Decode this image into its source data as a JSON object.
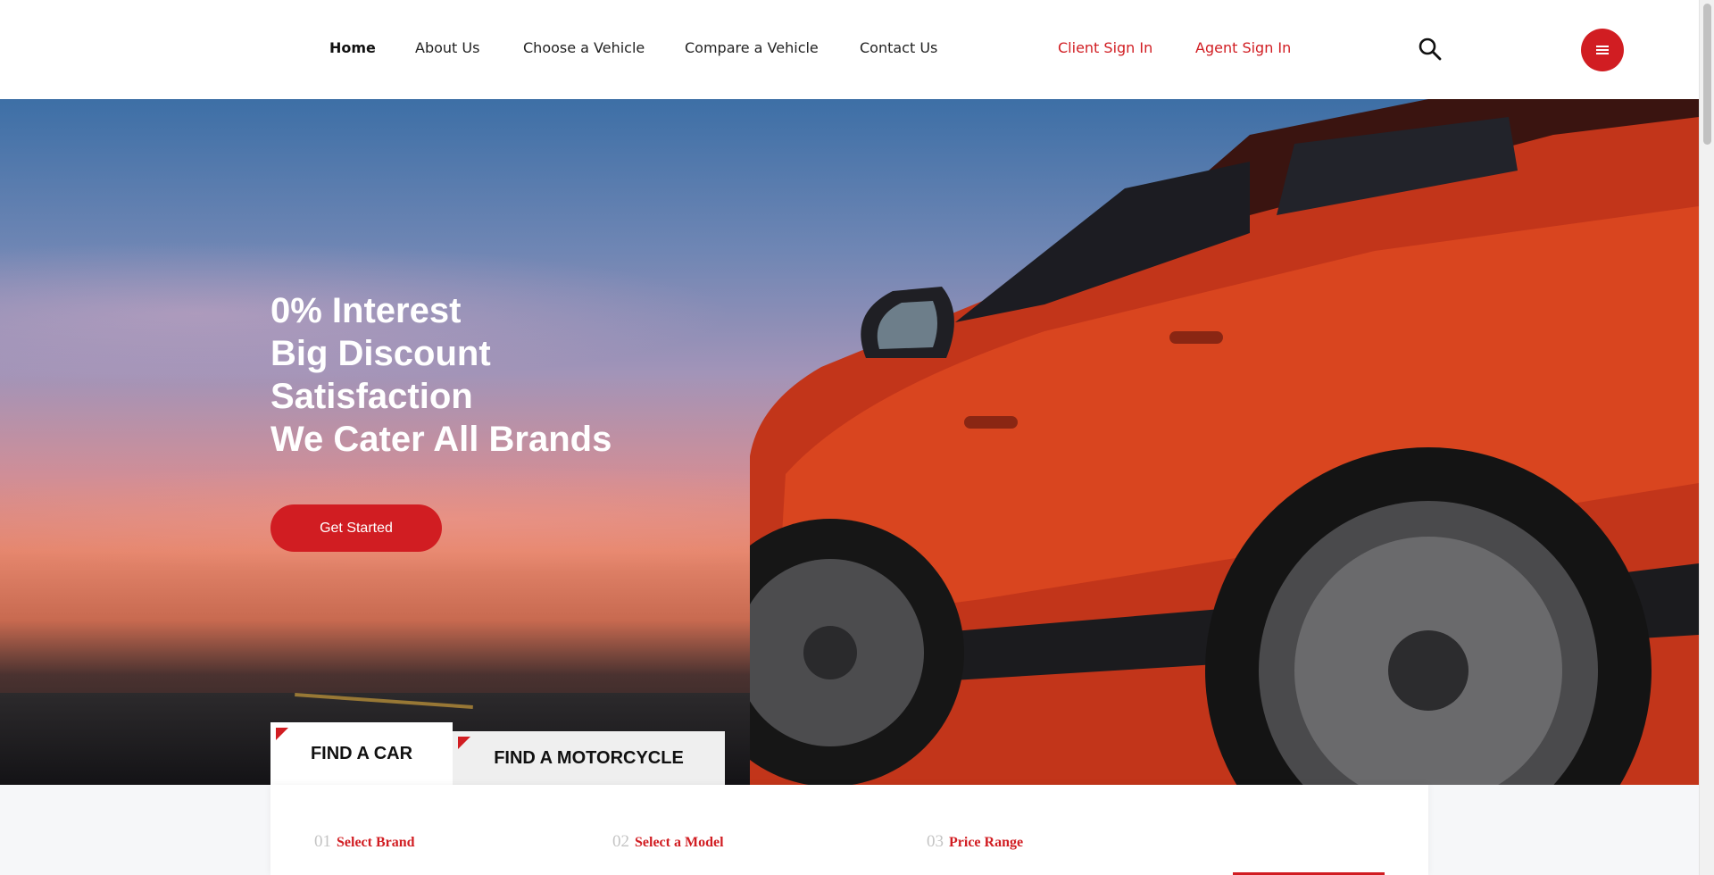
{
  "nav": {
    "items": [
      {
        "label": "Home",
        "active": true
      },
      {
        "label": "About Us"
      },
      {
        "label": "Choose a Vehicle"
      },
      {
        "label": "Compare a Vehicle"
      },
      {
        "label": "Contact Us"
      }
    ],
    "client_sign_in": "Client Sign In",
    "agent_sign_in": "Agent Sign In",
    "search_icon": "search-icon",
    "menu_icon": "hamburger-icon"
  },
  "hero": {
    "lines": [
      "0% Interest",
      "Big Discount",
      "Satisfaction",
      "We Cater All Brands"
    ],
    "cta_label": "Get Started"
  },
  "tabs": [
    {
      "label": "FIND A CAR",
      "active": true
    },
    {
      "label": "FIND A MOTORCYCLE",
      "active": false
    }
  ],
  "search_steps": [
    {
      "num": "01",
      "label": "Select Brand"
    },
    {
      "num": "02",
      "label": "Select a Model"
    },
    {
      "num": "03",
      "label": "Price Range"
    }
  ],
  "colors": {
    "accent": "#d11d22",
    "text": "#222222",
    "step_number": "#c4c4c4",
    "inactive_tab": "#efefef"
  }
}
